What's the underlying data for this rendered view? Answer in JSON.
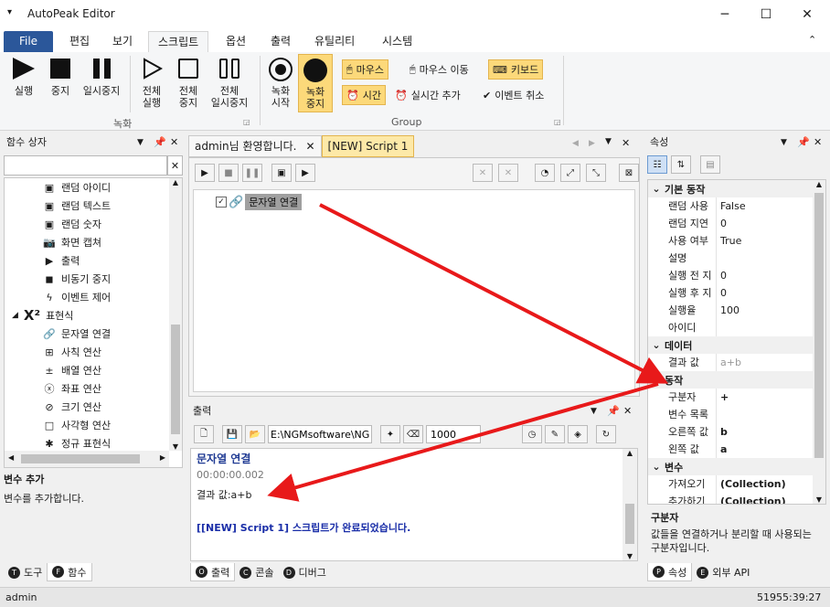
{
  "app": {
    "title": "AutoPeak Editor"
  },
  "menu": {
    "tabs": [
      "File",
      "편집",
      "보기",
      "스크립트",
      "옵션",
      "출력",
      "유틸리티",
      "시스템"
    ]
  },
  "ribbon": {
    "run": "실행",
    "stop": "중지",
    "pause": "일시중지",
    "run_all_1": "전체",
    "run_all_2": "실행",
    "stop_all_1": "전체",
    "stop_all_2": "중지",
    "pause_all_1": "전체",
    "pause_all_2": "일시중지",
    "rec_start_1": "녹화",
    "rec_start_2": "시작",
    "rec_stop_1": "녹화",
    "rec_stop_2": "중지",
    "mouse": "마우스",
    "mouse_move": "마우스 이동",
    "keyboard": "키보드",
    "time": "시간",
    "realtime_add": "실시간 추가",
    "event_cancel": "이벤트 취소",
    "group_record": "녹화",
    "group_group": "Group"
  },
  "func_panel": {
    "title": "함수 상자",
    "items": [
      "랜덤 아이디",
      "랜덤 텍스트",
      "랜덤 숫자",
      "화면 캡쳐",
      "출력",
      "비동기 중지",
      "이벤트 제어"
    ],
    "expr_group": "표현식",
    "expr_items": [
      "문자열 연결",
      "사칙 연산",
      "배열 연산",
      "좌표 연산",
      "크기 연산",
      "사각형 연산",
      "정규 표현식"
    ],
    "desc_title": "변수 추가",
    "desc_text": "변수를 추가합니다.",
    "tabs": [
      "도구",
      "함수"
    ]
  },
  "editor": {
    "tabs": [
      "admin님 환영합니다.",
      "[NEW] Script 1"
    ],
    "node_label": "문자열 연결"
  },
  "output": {
    "title": "출력",
    "path": "E:\\NGMsoftware\\NG",
    "count": "1000",
    "lines": [
      "문자열 연결",
      "00:00:00.002",
      "결과 값:a+b",
      "[[NEW] Script 1] 스크립트가 완료되었습니다."
    ],
    "tabs": [
      "출력",
      "콘솔",
      "디버그"
    ]
  },
  "props": {
    "title": "속성",
    "cat_basic": "기본 동작",
    "basic": [
      [
        "랜덤 사용",
        "False"
      ],
      [
        "랜덤 지연",
        "0"
      ],
      [
        "사용 여부",
        "True"
      ],
      [
        "설명",
        ""
      ],
      [
        "실행 전 지",
        "0"
      ],
      [
        "실행 후 지",
        "0"
      ],
      [
        "실행율",
        "100"
      ],
      [
        "아이디",
        ""
      ]
    ],
    "cat_data": "데이터",
    "data": [
      [
        "결과 값",
        "a+b"
      ]
    ],
    "cat_action": "동작",
    "action": [
      [
        "구분자",
        "+"
      ],
      [
        "변수 목록",
        ""
      ],
      [
        "오른쪽 값",
        "b"
      ],
      [
        "왼쪽 값",
        "a"
      ]
    ],
    "cat_var": "변수",
    "var": [
      [
        "가져오기",
        "(Collection)"
      ],
      [
        "추가하기",
        "(Collection)"
      ]
    ],
    "desc_title": "구분자",
    "desc_text": "값들을 연결하거나 분리할 때 사용되는 구분자입니다.",
    "tabs": [
      "속성",
      "외부 API"
    ]
  },
  "status": {
    "user": "admin",
    "time": "51955:39:27"
  },
  "colors": {
    "accent": "#2b579a",
    "highlight": "#fcd97a",
    "arrow": "#e8191a"
  }
}
